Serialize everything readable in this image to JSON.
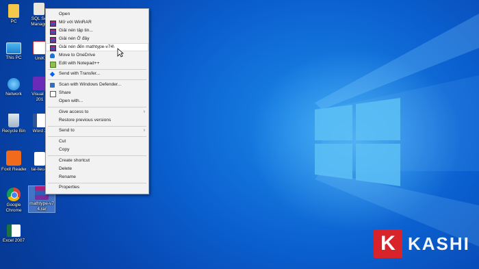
{
  "desktop": {
    "icons": [
      {
        "label": "PC"
      },
      {
        "label": "SQL Se Manage"
      },
      {
        "label": "This PC"
      },
      {
        "label": "UniK"
      },
      {
        "label": "Network"
      },
      {
        "label": "Visual S 201"
      },
      {
        "label": "Recycle Bin"
      },
      {
        "label": "Word 2"
      },
      {
        "label": "Foxit Reader"
      },
      {
        "label": "tai-lieu-c"
      },
      {
        "label": "Google Chrome"
      },
      {
        "label": "mathtype-v7 4.rar"
      },
      {
        "label": "Excel 2007"
      }
    ]
  },
  "context_menu": {
    "items": [
      {
        "label": "Open"
      },
      {
        "label": "Mở với WinRAR",
        "icon": "winrar-icon"
      },
      {
        "label": "Giải nén tập tin...",
        "icon": "winrar-icon"
      },
      {
        "label": "Giải nén Ở đây",
        "icon": "winrar-icon"
      },
      {
        "label": "Giải nén đến mathtype-v74\\",
        "icon": "winrar-icon"
      },
      {
        "label": "Move to OneDrive",
        "icon": "onedrive-icon"
      },
      {
        "label": "Edit with Notepad++",
        "icon": "notepad-plus-plus-icon"
      },
      {
        "label": "Send with Transfer...",
        "icon": "dropbox-icon"
      },
      {
        "label": "Scan with Windows Defender...",
        "icon": "defender-icon"
      },
      {
        "label": "Share",
        "icon": "share-icon"
      },
      {
        "label": "Open with..."
      },
      {
        "label": "Give access to"
      },
      {
        "label": "Restore previous versions"
      },
      {
        "label": "Send to"
      },
      {
        "label": "Cut"
      },
      {
        "label": "Copy"
      },
      {
        "label": "Create shortcut"
      },
      {
        "label": "Delete"
      },
      {
        "label": "Rename"
      },
      {
        "label": "Properties"
      }
    ],
    "hovered": "Giải nén đến mathtype-v74\\"
  },
  "watermark": {
    "letter": "K",
    "text": "KASHI",
    "color": "#d9232a"
  },
  "colors": {
    "wallpaper": "#0a5fcf",
    "menu_bg": "#f2f2f2"
  }
}
